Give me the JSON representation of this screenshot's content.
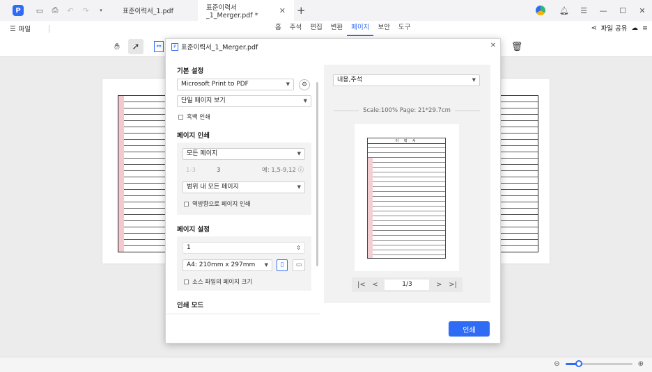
{
  "window": {
    "tabs": [
      {
        "label": "표준이력서_1.pdf",
        "active": false
      },
      {
        "label": "표준이력서_1_Merger.pdf *",
        "active": true
      }
    ],
    "add_tab": "+",
    "minimize": "—",
    "maximize": "☐",
    "close": "✕"
  },
  "menubar": {
    "file_label": "파일",
    "tabs": [
      "홈",
      "주석",
      "편집",
      "변환",
      "페이지",
      "보안",
      "도구"
    ],
    "active_tab": "페이지",
    "share_label": "파일 공유"
  },
  "dialog": {
    "title": "표준이력서_1_Merger.pdf",
    "basic_settings_title": "기본 설정",
    "printer": "Microsoft Print to PDF",
    "view_mode": "단일 페이지 보기",
    "grayscale_label": "흑백 인쇄",
    "page_print_title": "페이지 인쇄",
    "page_range": "모든 페이지",
    "range_placeholder": "1-3",
    "range_total": "3",
    "range_example": "예: 1,5-9,12",
    "subset": "범위 내 모든 페이지",
    "reverse_label": "역방향으로 페이지 인쇄",
    "page_setup_title": "페이지 설정",
    "copies": "1",
    "paper_size": "A4: 210mm x 297mm",
    "source_size_label": "소스 파일의 페이지 크기",
    "print_mode_title": "인쇄 모드",
    "content_option": "내용,주석",
    "scale_info": "Scale:100%   Page: 21*29.7cm",
    "pager_value": "1/3",
    "preview_heading": "이 력 서",
    "print_button": "인쇄"
  },
  "colors": {
    "accent": "#2f6cf6",
    "form_highlight": "#f1c9cf"
  }
}
